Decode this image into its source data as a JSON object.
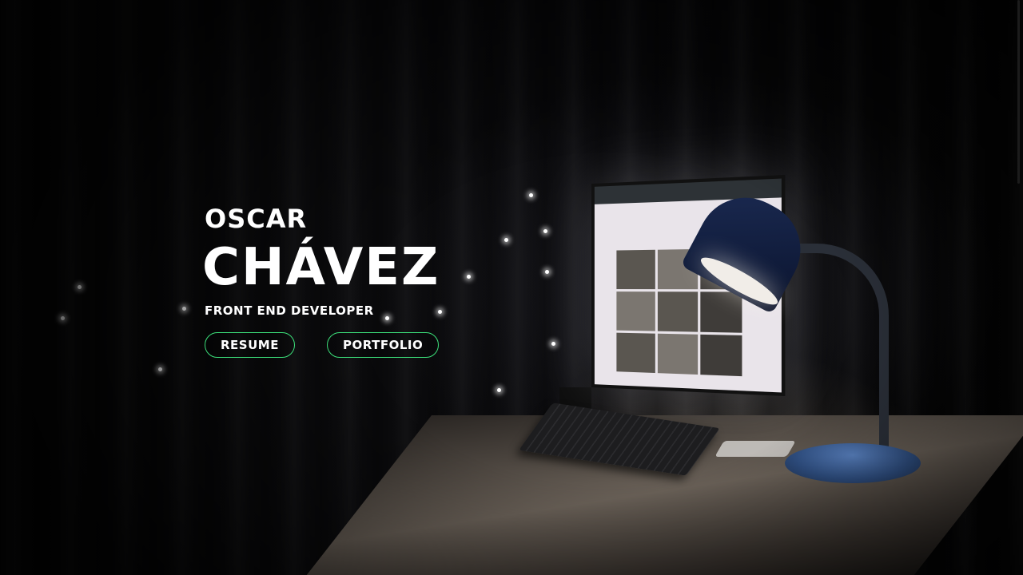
{
  "hero": {
    "first_name": "OSCAR",
    "last_name": "CHÁVEZ",
    "role": "FRONT END DEVELOPER"
  },
  "buttons": {
    "resume_label": "RESUME",
    "portfolio_label": "PORTFOLIO"
  },
  "colors": {
    "accent_border": "#3ce07a",
    "text": "#ffffff",
    "background": "#050505"
  }
}
